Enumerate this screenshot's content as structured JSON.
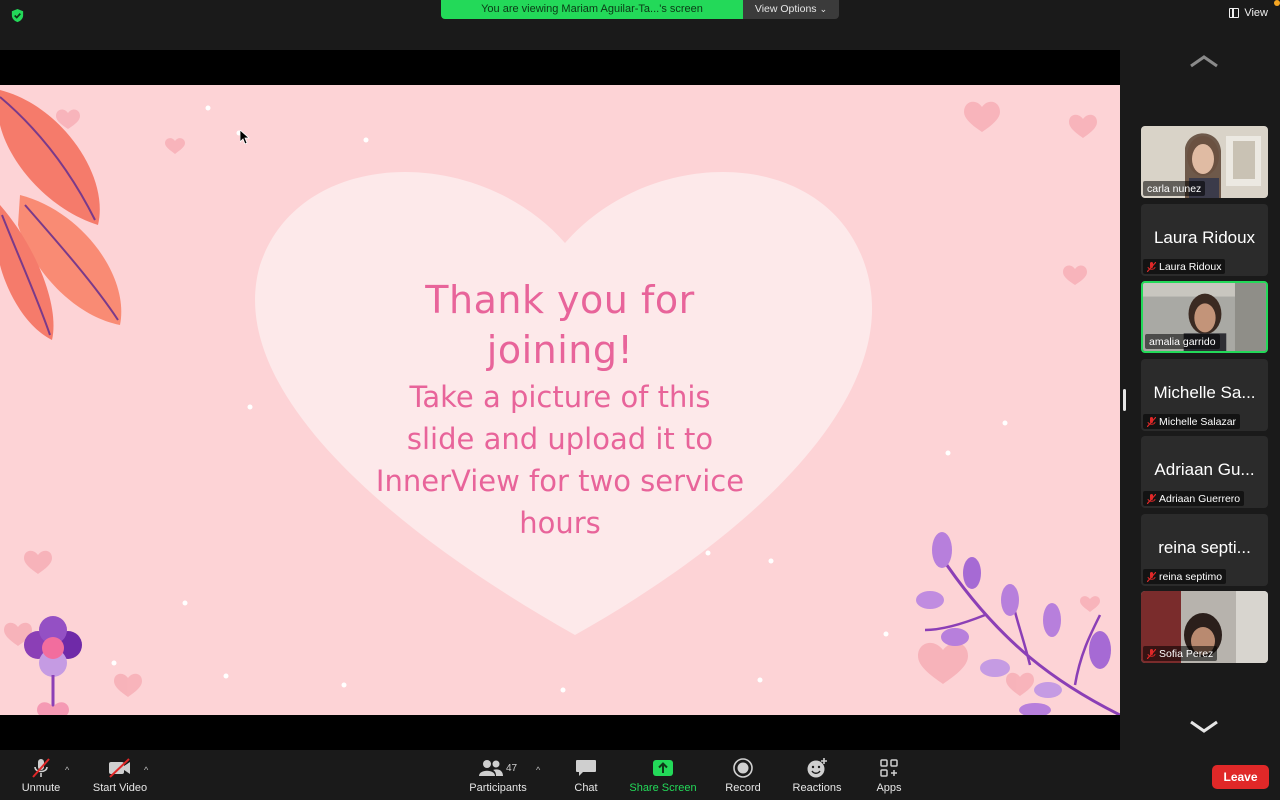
{
  "top_bar": {
    "banner_text": "You are viewing Mariam Aguilar-Ta...'s screen",
    "view_options_label": "View Options",
    "view_label": "View"
  },
  "slide": {
    "title_line1": "Thank you for",
    "title_line2": "joining!",
    "body_line1": "Take a picture of this",
    "body_line2": "slide and upload it to",
    "body_line3": "InnerView for two service",
    "body_line4": "hours"
  },
  "participants_gallery": [
    {
      "name": "carla nunez",
      "big_name": "",
      "video": true,
      "muted": false,
      "speaking": false
    },
    {
      "name": "Laura Ridoux",
      "big_name": "Laura Ridoux",
      "video": false,
      "muted": true,
      "speaking": false
    },
    {
      "name": "amalia garrido",
      "big_name": "",
      "video": true,
      "muted": false,
      "speaking": true
    },
    {
      "name": "Michelle Salazar",
      "big_name": "Michelle Sa...",
      "video": false,
      "muted": true,
      "speaking": false
    },
    {
      "name": "Adriaan Guerrero",
      "big_name": "Adriaan Gu...",
      "video": false,
      "muted": true,
      "speaking": false
    },
    {
      "name": "reina septimo",
      "big_name": "reina septi...",
      "video": false,
      "muted": true,
      "speaking": false
    },
    {
      "name": "Sofia Perez",
      "big_name": "",
      "video": true,
      "muted": true,
      "speaking": false
    }
  ],
  "toolbar": {
    "unmute_label": "Unmute",
    "start_video_label": "Start Video",
    "participants_label": "Participants",
    "participants_count": "47",
    "chat_label": "Chat",
    "share_screen_label": "Share Screen",
    "record_label": "Record",
    "reactions_label": "Reactions",
    "apps_label": "Apps",
    "leave_label": "Leave"
  },
  "colors": {
    "accent_green": "#23d959",
    "leave_red": "#e02828",
    "slide_pink": "#fdd3d6",
    "slide_text": "#e8649a"
  }
}
